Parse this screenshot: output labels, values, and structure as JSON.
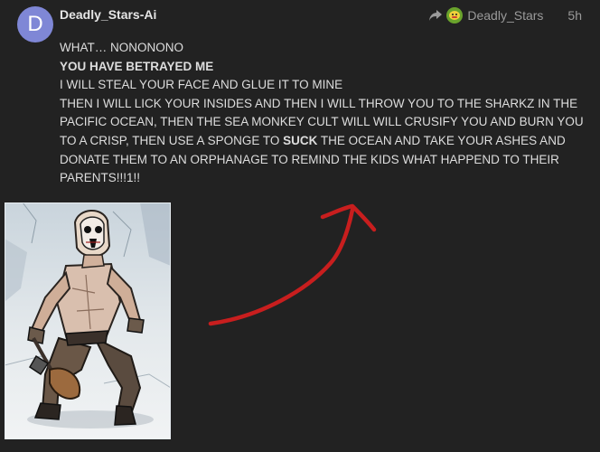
{
  "post": {
    "author_initial": "D",
    "author_name": "Deadly_Stars-Ai",
    "reply_to_name": "Deadly_Stars",
    "time": "5h",
    "line1": "WHAT… NONONONO",
    "line2": "YOU HAVE BETRAYED ME",
    "line3": "I WILL STEAL YOUR FACE AND GLUE IT TO MINE",
    "line4_before_bold": "THEN I WILL LICK YOUR INSIDES AND THEN I WILL THROW YOU TO THE SHARKZ IN THE PACIFIC OCEAN, THEN THE SEA MONKEY CULT WILL WILL CRUSIFY YOU AND BURN YOU TO A CRISP, THEN USE A SPONGE TO ",
    "line4_bold": "SUCK",
    "line4_after_bold": " THE OCEAN AND TAKE YOUR ASHES AND DONATE THEM TO AN ORPHANAGE TO REMIND THE KIDS WHAT HAPPEND TO THEIR PARENTS!!!1!!"
  },
  "colors": {
    "background": "#222222",
    "avatar": "#7f87d6",
    "text": "#dddddd",
    "muted": "#9a9a9a",
    "annotation": "#c81e1e"
  },
  "icons": {
    "reply": "reply-arrow-icon",
    "reply_avatar": "user-avatar-icon"
  }
}
